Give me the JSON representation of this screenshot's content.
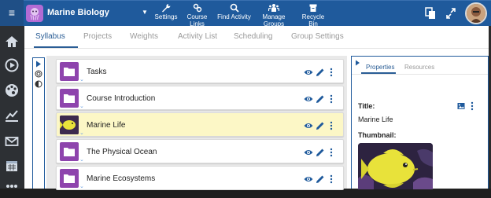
{
  "app": {
    "title": "Marine Biology"
  },
  "toolbar": {
    "items": [
      {
        "label": "Settings",
        "icon": "wrench-icon"
      },
      {
        "label": "Course Links",
        "icon": "links-icon"
      },
      {
        "label": "Find Activity",
        "icon": "search-icon"
      },
      {
        "label": "Manage Groups",
        "icon": "groups-icon"
      },
      {
        "label": "Recycle Bin",
        "icon": "recycle-bin-icon"
      }
    ]
  },
  "tabs": [
    {
      "label": "Syllabus",
      "active": true
    },
    {
      "label": "Projects"
    },
    {
      "label": "Weights"
    },
    {
      "label": "Activity List"
    },
    {
      "label": "Scheduling"
    },
    {
      "label": "Group Settings"
    }
  ],
  "rows": [
    {
      "title": "Tasks",
      "type": "folder"
    },
    {
      "title": "Course Introduction",
      "type": "folder"
    },
    {
      "title": "Marine Life",
      "type": "image",
      "selected": true
    },
    {
      "title": "The Physical Ocean",
      "type": "folder"
    },
    {
      "title": "Marine Ecosystems",
      "type": "folder"
    }
  ],
  "side": {
    "tabs": [
      {
        "label": "Properties",
        "active": true
      },
      {
        "label": "Resources"
      }
    ],
    "title_label": "Title:",
    "title_value": "Marine Life",
    "thumbnail_label": "Thumbnail:"
  },
  "colors": {
    "topbar": "#1f5a9c",
    "folder": "#8e44ad",
    "selected_row": "#fcf7c6",
    "accent": "#2a5d95"
  }
}
